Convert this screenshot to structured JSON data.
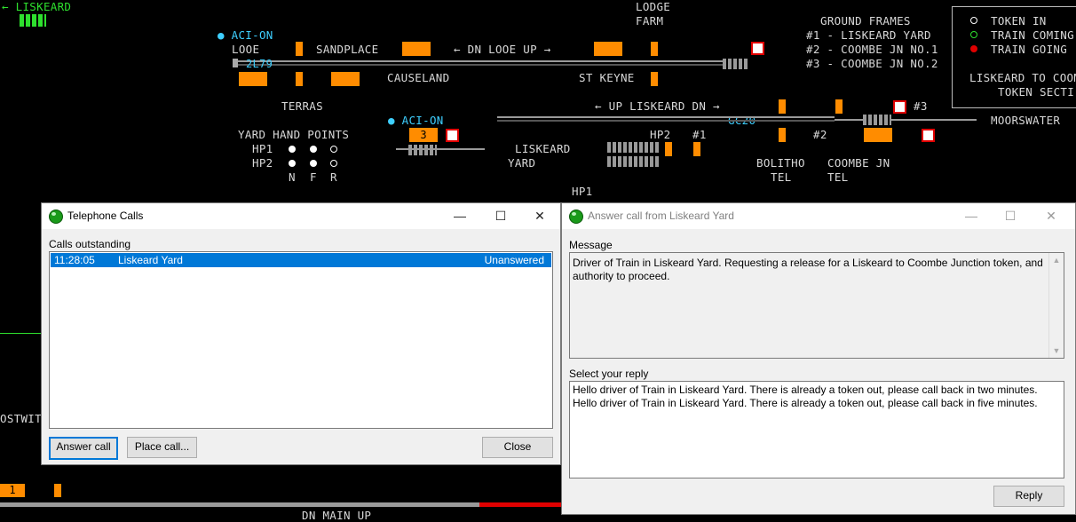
{
  "schematic": {
    "top_left_label": "← LISKEARD",
    "aci_on_1": "● ACI-ON",
    "aci_on_2": "● ACI-ON",
    "looe": "LOOE",
    "sandplace": "SANDPLACE",
    "dn_looe_up": "← DN LOOE UP →",
    "lodge": "LODGE",
    "farm": "FARM",
    "train_2l79": "2L79",
    "causeland": "CAUSELAND",
    "st_keyne": "ST KEYNE",
    "terras": "TERRAS",
    "up_liskeard_dn": "← UP LISKEARD DN →",
    "gc20": "GC20",
    "yard_hand_points": "YARD HAND POINTS",
    "hp1": "HP1",
    "hp2": "HP2",
    "n": "N",
    "f": "F",
    "r": "R",
    "block_3": "3",
    "liskeard": "LISKEARD",
    "yard": "YARD",
    "hp2b": "HP2",
    "hash1": "#1",
    "hp1b": "HP1",
    "bolitho": "BOLITHO",
    "tel1": "TEL",
    "coombe_jn": "COOMBE JN",
    "tel2": "TEL",
    "hash2": "#2",
    "hash3": "#3",
    "moorswater": "MOORSWATER",
    "ground_frames": "GROUND FRAMES",
    "gf1": "#1 - LISKEARD YARD",
    "gf2": "#2 - COOMBE JN NO.1",
    "gf3": "#3 - COOMBE JN NO.2",
    "legend_token_in": "TOKEN IN",
    "legend_train_coming": "TRAIN COMING",
    "legend_train_going": "TRAIN GOING",
    "legend_liskeard_to": "LISKEARD TO COOM",
    "legend_token_section": "TOKEN SECTI",
    "left_cut": "OSTWIT",
    "bottom_block": "1",
    "dn_main_up": "DN MAIN UP"
  },
  "telephone_window": {
    "title": "Telephone Calls",
    "calls_label": "Calls outstanding",
    "calls": [
      {
        "time": "11:28:05",
        "from": "Liskeard Yard",
        "status": "Unanswered"
      }
    ],
    "answer_button": "Answer call",
    "place_button": "Place call...",
    "close_button": "Close"
  },
  "answer_window": {
    "title": "Answer call from Liskeard Yard",
    "message_label": "Message",
    "message_text": "Driver of Train in Liskeard Yard. Requesting a release for a Liskeard to Coombe Junction token, and authority to proceed.",
    "reply_label": "Select your reply",
    "replies": [
      "Hello driver of Train in Liskeard Yard. There is already a token out, please call back in two minutes.",
      "Hello driver of Train in Liskeard Yard. There is already a token out, please call back in five minutes."
    ],
    "reply_button": "Reply"
  },
  "window_controls": {
    "minimize": "—",
    "maximize": "☐",
    "close": "✕"
  },
  "colors": {
    "selection": "#0078d7",
    "block": "#ff8c00",
    "track": "#9a9a9a",
    "signal_red": "#e00000"
  }
}
